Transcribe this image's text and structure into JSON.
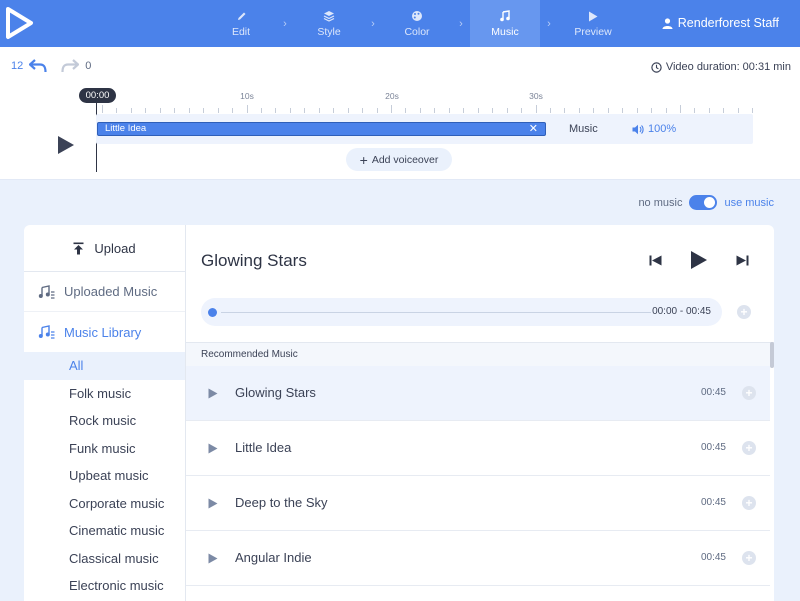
{
  "nav": {
    "steps": [
      {
        "label": "Edit",
        "icon": "pencil-icon",
        "active": false
      },
      {
        "label": "Style",
        "icon": "layers-icon",
        "active": false
      },
      {
        "label": "Color",
        "icon": "palette-icon",
        "active": false
      },
      {
        "label": "Music",
        "icon": "music-note-icon",
        "active": true
      },
      {
        "label": "Preview",
        "icon": "play-icon",
        "active": false
      }
    ],
    "user": "Renderforest Staff"
  },
  "history": {
    "undo_count": "12",
    "redo_count": "0"
  },
  "video_duration": "Video duration: 00:31 min",
  "timeline": {
    "playhead": "00:00",
    "ruler_labels": [
      "10s",
      "20s",
      "30s"
    ],
    "clip_name": "Little Idea",
    "track_label": "Music",
    "volume": "100%",
    "add_voiceover": "Add voiceover"
  },
  "music_toggle": {
    "off_label": "no music",
    "on_label": "use music",
    "enabled": true
  },
  "sidebar": {
    "upload": "Upload",
    "uploaded_music": "Uploaded Music",
    "music_library": "Music Library",
    "genres": [
      "All",
      "Folk music",
      "Rock music",
      "Funk music",
      "Upbeat music",
      "Corporate music",
      "Cinematic music",
      "Classical music",
      "Electronic music"
    ],
    "active_genre": "All"
  },
  "player": {
    "title": "Glowing Stars",
    "time": "00:00 - 00:45"
  },
  "list": {
    "header": "Recommended Music",
    "songs": [
      {
        "name": "Glowing Stars",
        "duration": "00:45"
      },
      {
        "name": "Little Idea",
        "duration": "00:45"
      },
      {
        "name": "Deep to the Sky",
        "duration": "00:45"
      },
      {
        "name": "Angular Indie",
        "duration": "00:45"
      }
    ]
  },
  "colors": {
    "accent": "#4b82ea",
    "topbar": "#4b82ea",
    "background": "#eaf1fc",
    "dark": "#2e3445"
  }
}
